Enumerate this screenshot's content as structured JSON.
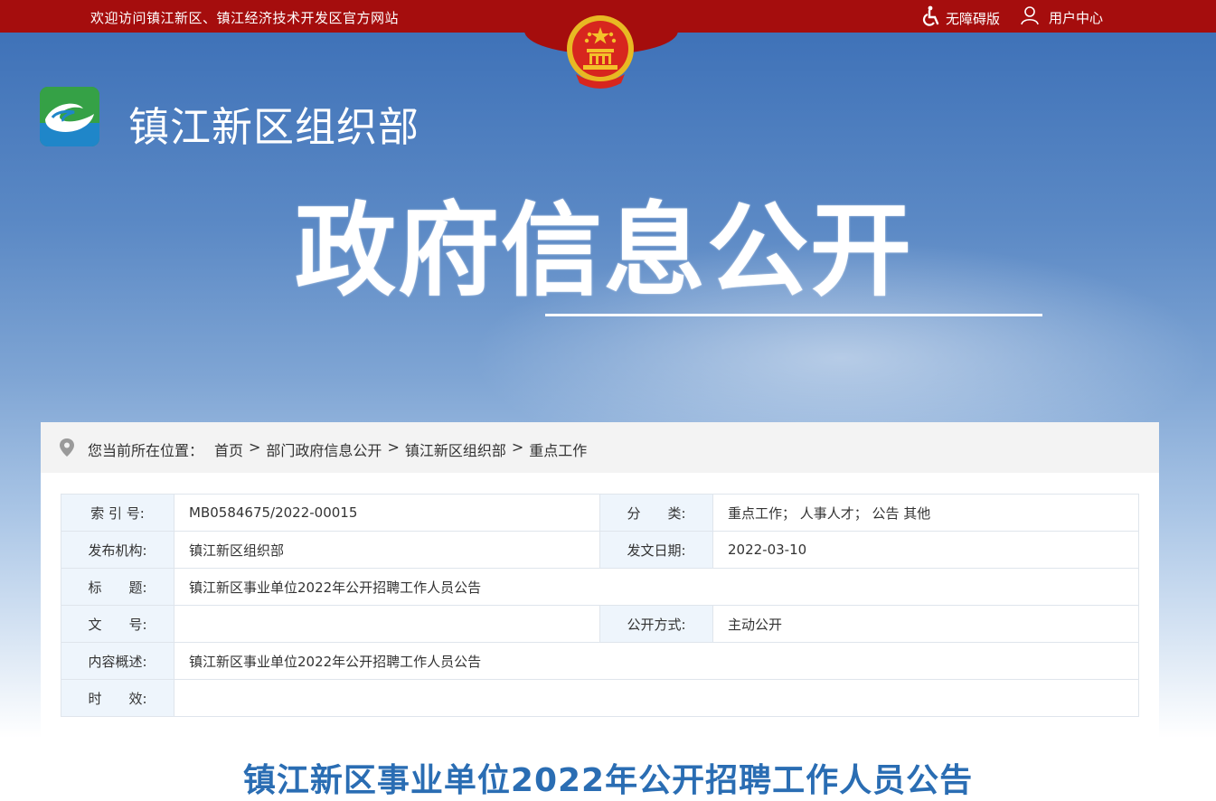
{
  "topbar": {
    "welcome": "欢迎访问镇江新区、镇江经济技术开发区官方网站",
    "accessible": "无障碍版",
    "user_center": "用户中心"
  },
  "site": {
    "name": "镇江新区组织部",
    "banner_title": "政府信息公开"
  },
  "breadcrumb": {
    "lead": "您当前所在位置：",
    "items": [
      "首页",
      "部门政府信息公开",
      "镇江新区组织部",
      "重点工作"
    ],
    "sep": ">"
  },
  "meta": {
    "index_label": "索 引 号:",
    "index_value": "MB0584675/2022-00015",
    "category_label": "分　　类:",
    "category_value": "重点工作；  人事人才；  公告 其他",
    "publisher_label": "发布机构:",
    "publisher_value": "镇江新区组织部",
    "date_label": "发文日期:",
    "date_value": "2022-03-10",
    "title_label": "标　　题:",
    "title_value": "镇江新区事业单位2022年公开招聘工作人员公告",
    "docno_label": "文　　号:",
    "docno_value": "",
    "mode_label": "公开方式:",
    "mode_value": "主动公开",
    "summary_label": "内容概述:",
    "summary_value": "镇江新区事业单位2022年公开招聘工作人员公告",
    "validity_label": "时　　效:",
    "validity_value": ""
  },
  "article": {
    "title": "镇江新区事业单位2022年公开招聘工作人员公告"
  },
  "colors": {
    "topbar": "#a50d0d",
    "title_blue": "#2a6db3",
    "label_bg": "#eef5fc"
  }
}
